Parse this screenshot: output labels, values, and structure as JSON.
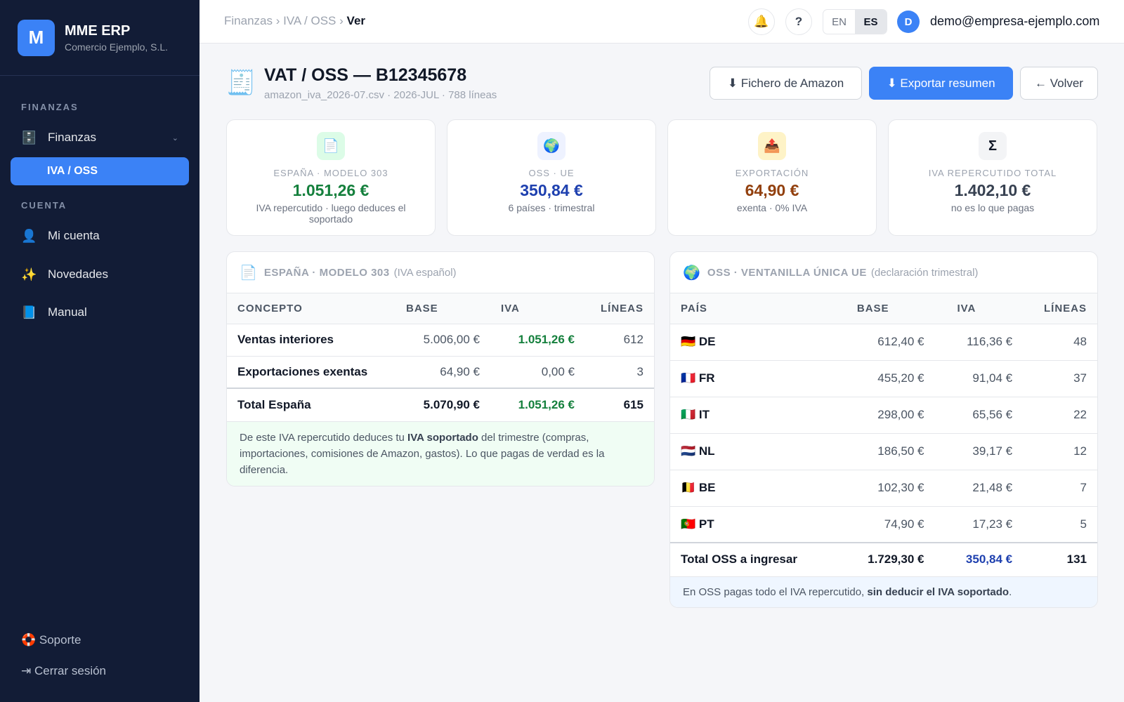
{
  "sidebar": {
    "brand_letter": "M",
    "brand_name": "MME ERP",
    "brand_sub": "Comercio Ejemplo, S.L.",
    "section_finanzas": "FINANZAS",
    "finanzas_label": "Finanzas",
    "finanzas_chevron": "⌄",
    "iva_oss_label": "IVA / OSS",
    "section_cuenta": "CUENTA",
    "mi_cuenta_label": "Mi cuenta",
    "novedades_label": "Novedades",
    "manual_label": "Manual",
    "soporte_label": "🛟 Soporte",
    "logout_label": "⇥ Cerrar sesión"
  },
  "topbar": {
    "crumb_1": "Finanzas",
    "sep": "›",
    "crumb_2": "IVA / OSS",
    "crumb_3": "Ver",
    "bell": "🔔",
    "help": "?",
    "lang_en": "EN",
    "lang_es": "ES",
    "avatar_letter": "D",
    "user_email": "demo@empresa-ejemplo.com"
  },
  "header": {
    "icon": "🧾",
    "title": "VAT / OSS — B12345678",
    "subtitle": "amazon_iva_2026-07.csv · 2026-JUL · 788 líneas",
    "btn_amazon": "⬇ Fichero de Amazon",
    "btn_export": "⬇ Exportar resumen",
    "btn_back": "← Volver"
  },
  "cards": [
    {
      "icon": "📄",
      "label": "ESPAÑA · MODELO 303",
      "value": "1.051,26 €",
      "note": "IVA repercutido · luego deduces el soportado",
      "color": "#15803d",
      "bg": "#dcfce7"
    },
    {
      "icon": "🌍",
      "label": "OSS · UE",
      "value": "350,84 €",
      "note": "6 países · trimestral",
      "color": "#1e40af",
      "bg": "#eef2ff"
    },
    {
      "icon": "📤",
      "label": "EXPORTACIÓN",
      "value": "64,90 €",
      "note": "exenta · 0% IVA",
      "color": "#92400e",
      "bg": "#fef3c7"
    },
    {
      "icon": "Σ",
      "label": "IVA REPERCUTIDO TOTAL",
      "value": "1.402,10 €",
      "note": "no es lo que pagas",
      "color": "#374151",
      "bg": "#f3f4f6"
    }
  ],
  "spain": {
    "icon": "📄",
    "title": "ESPAÑA · MODELO 303",
    "subtitle": "(IVA español)",
    "headers": [
      "CONCEPTO",
      "BASE",
      "IVA",
      "LÍNEAS"
    ],
    "rows": [
      {
        "concept": "Ventas interiores",
        "base": "5.006,00 €",
        "iva": "1.051,26 €",
        "lines": "612"
      },
      {
        "concept": "Exportaciones exentas",
        "base": "64,90 €",
        "iva": "0,00 €",
        "lines": "3"
      }
    ],
    "total": {
      "concept": "Total España",
      "base": "5.070,90 €",
      "iva": "1.051,26 €",
      "lines": "615"
    },
    "note_pre": "De este IVA repercutido deduces tu ",
    "note_bold": "IVA soportado",
    "note_post": " del trimestre (compras, importaciones, comisiones de Amazon, gastos). Lo que pagas de verdad es la diferencia."
  },
  "oss": {
    "icon": "🌍",
    "title": "OSS · VENTANILLA ÚNICA UE",
    "subtitle": "(declaración trimestral)",
    "headers": [
      "PAÍS",
      "BASE",
      "IVA",
      "LÍNEAS"
    ],
    "rows": [
      {
        "flag": "🇩🇪",
        "country": "DE",
        "base": "612,40 €",
        "iva": "116,36 €",
        "lines": "48"
      },
      {
        "flag": "🇫🇷",
        "country": "FR",
        "base": "455,20 €",
        "iva": "91,04 €",
        "lines": "37"
      },
      {
        "flag": "🇮🇹",
        "country": "IT",
        "base": "298,00 €",
        "iva": "65,56 €",
        "lines": "22"
      },
      {
        "flag": "🇳🇱",
        "country": "NL",
        "base": "186,50 €",
        "iva": "39,17 €",
        "lines": "12"
      },
      {
        "flag": "🇧🇪",
        "country": "BE",
        "base": "102,30 €",
        "iva": "21,48 €",
        "lines": "7"
      },
      {
        "flag": "🇵🇹",
        "country": "PT",
        "base": "74,90 €",
        "iva": "17,23 €",
        "lines": "5"
      }
    ],
    "total": {
      "concept": "Total OSS a ingresar",
      "base": "1.729,30 €",
      "iva": "350,84 €",
      "lines": "131"
    },
    "note_pre": "En OSS pagas todo el IVA repercutido, ",
    "note_bold": "sin deducir el IVA soportado",
    "note_post": "."
  }
}
